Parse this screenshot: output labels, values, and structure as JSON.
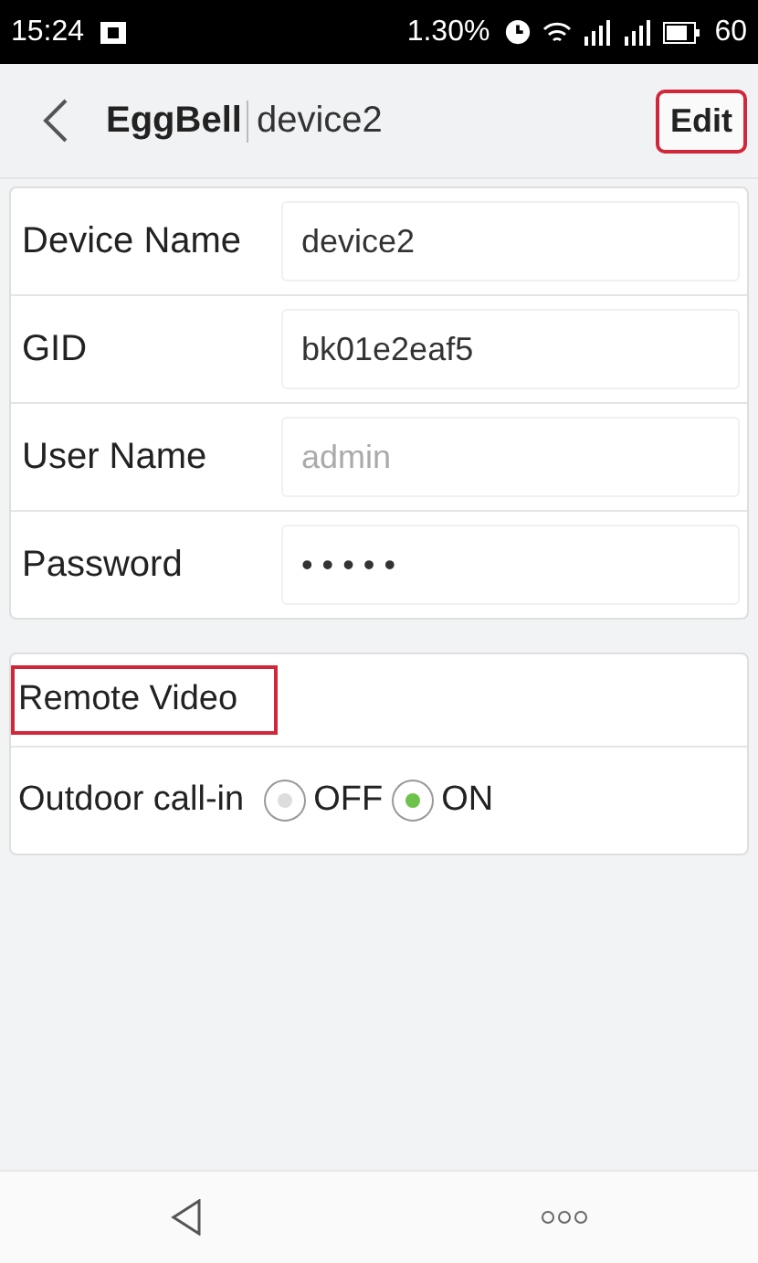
{
  "status_bar": {
    "time": "15:24",
    "speed": "1.30%",
    "battery": "60"
  },
  "header": {
    "app_name": "EggBell",
    "device": "device2",
    "action": {
      "label": "Edit",
      "highlighted": true
    }
  },
  "fields": [
    {
      "label": "Device Name",
      "value": "device2"
    },
    {
      "label": "GID",
      "value": "bk01e2eaf5"
    },
    {
      "label": "User Name",
      "placeholder": "admin"
    },
    {
      "label": "Password",
      "value": "• • • • •"
    }
  ],
  "remote_video": {
    "label": "Remote Video",
    "highlighted": true
  },
  "outdoor_call_in": {
    "label": "Outdoor call-in",
    "options": [
      {
        "label": "OFF",
        "selected": false
      },
      {
        "label": "ON",
        "selected": true
      }
    ]
  }
}
